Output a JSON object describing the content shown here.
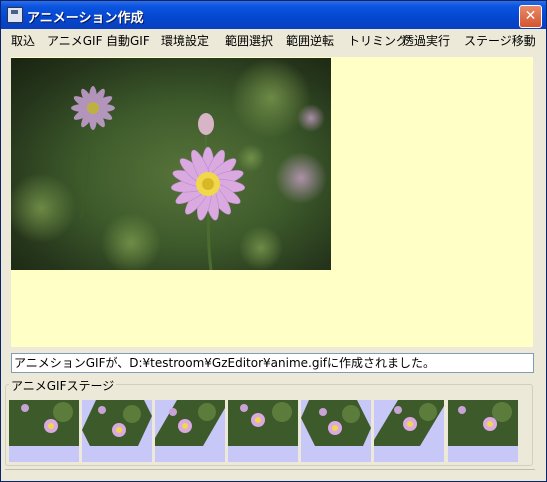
{
  "window": {
    "title": "アニメーション作成",
    "close_label": "✕"
  },
  "menu": {
    "items": [
      "取込",
      "アニメGIF",
      "自動GIF",
      "環境設定",
      "範囲選択",
      "範囲逆転",
      "トリミング",
      "透過実行",
      "ステージ移動"
    ]
  },
  "status": {
    "message": "アニメションGIFが、D:¥testroom¥GzEditor¥anime.gifに作成されました。"
  },
  "stage": {
    "label": "アニメGIFステージ",
    "frames": [
      {
        "name": "frame-1",
        "shape": "rect"
      },
      {
        "name": "frame-2",
        "shape": "hexagon-slant"
      },
      {
        "name": "frame-3",
        "shape": "rhombus"
      },
      {
        "name": "frame-4",
        "shape": "rect"
      },
      {
        "name": "frame-5",
        "shape": "hexagon-slant"
      },
      {
        "name": "frame-6",
        "shape": "rhombus"
      },
      {
        "name": "frame-7",
        "shape": "rect"
      }
    ]
  },
  "colors": {
    "canvas_bg": "#ffffc6",
    "stage_bg": "#c8c8f8",
    "titlebar": "#0b55e0"
  }
}
